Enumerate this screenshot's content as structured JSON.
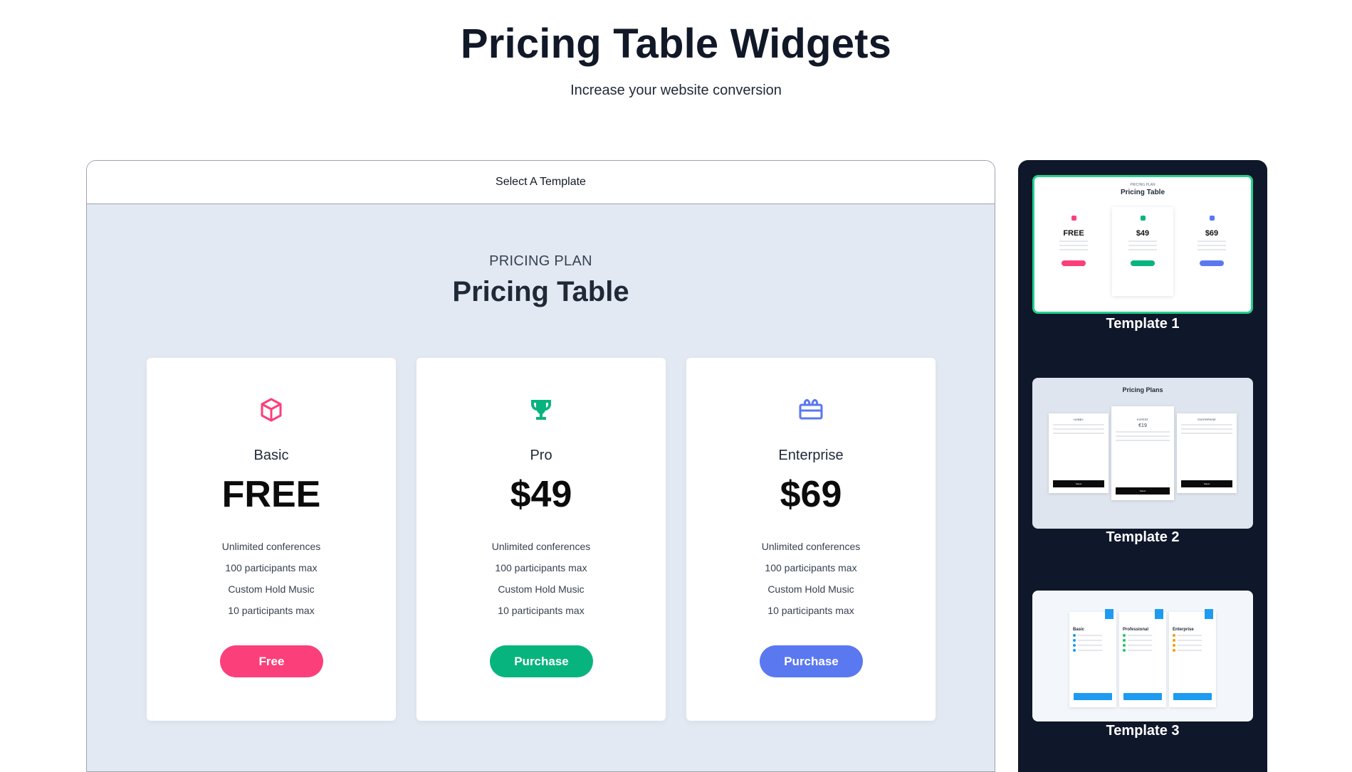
{
  "header": {
    "title": "Pricing Table Widgets",
    "subtitle": "Increase your website conversion"
  },
  "preview": {
    "bar_label": "Select A Template",
    "eyebrow": "PRICING PLAN",
    "heading": "Pricing Table",
    "plans": [
      {
        "name": "Basic",
        "price": "FREE",
        "icon": "cube-icon",
        "icon_color": "#fb3f7a",
        "features": [
          "Unlimited conferences",
          "100 participants max",
          "Custom Hold Music",
          "10 participants max"
        ],
        "cta": "Free",
        "cta_color": "#fb3f7a"
      },
      {
        "name": "Pro",
        "price": "$49",
        "icon": "trophy-icon",
        "icon_color": "#08b47d",
        "features": [
          "Unlimited conferences",
          "100 participants max",
          "Custom Hold Music",
          "10 participants max"
        ],
        "cta": "Purchase",
        "cta_color": "#08b47d"
      },
      {
        "name": "Enterprise",
        "price": "$69",
        "icon": "gift-box-icon",
        "icon_color": "#5a78f0",
        "features": [
          "Unlimited conferences",
          "100 participants max",
          "Custom Hold Music",
          "10 participants max"
        ],
        "cta": "Purchase",
        "cta_color": "#5a78f0"
      }
    ]
  },
  "sidebar": {
    "templates": [
      {
        "label": "Template 1",
        "selected": true,
        "accent": "#23d18b",
        "thumb": {
          "eyebrow": "PRICING PLAN",
          "title": "Pricing Table",
          "prices": [
            "FREE",
            "$49",
            "$69"
          ]
        }
      },
      {
        "label": "Template 2",
        "selected": false,
        "thumb": {
          "title": "Pricing Plans",
          "plans": [
            "HOBBY",
            "EXPERT",
            "ENTERPRISE"
          ],
          "price": "€19",
          "buttons": [
            "Select",
            "Select",
            "Select"
          ]
        }
      },
      {
        "label": "Template 3",
        "selected": false,
        "thumb": {
          "plans": [
            "Basic",
            "Professional",
            "Enterprise"
          ]
        }
      }
    ]
  }
}
